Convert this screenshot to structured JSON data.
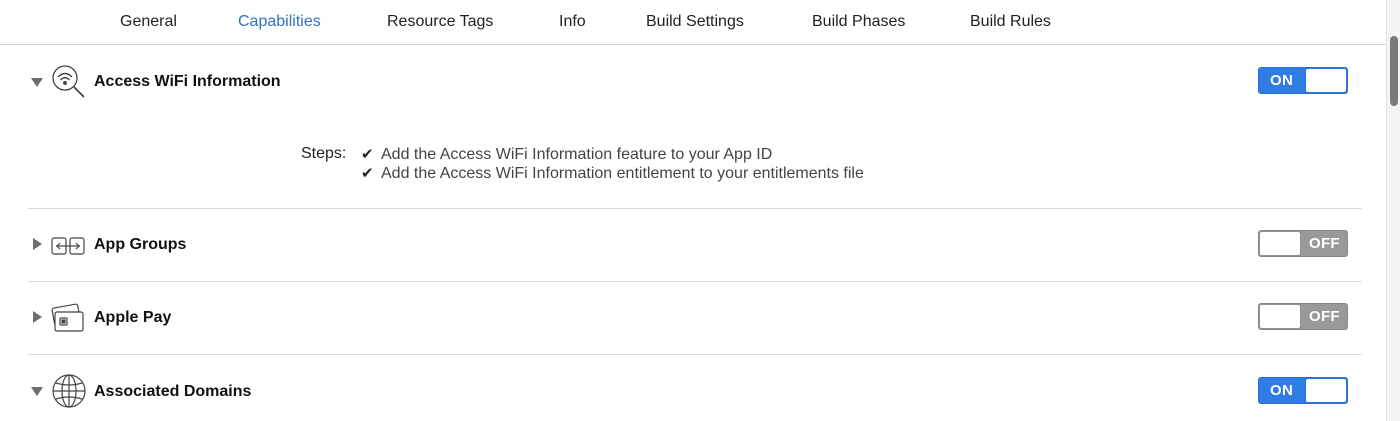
{
  "tabs": [
    {
      "label": "General"
    },
    {
      "label": "Capabilities",
      "active": true
    },
    {
      "label": "Resource Tags"
    },
    {
      "label": "Info"
    },
    {
      "label": "Build Settings"
    },
    {
      "label": "Build Phases"
    },
    {
      "label": "Build Rules"
    }
  ],
  "capabilities": [
    {
      "title": "Access WiFi Information",
      "icon": "wifi-search-icon",
      "expanded": true,
      "toggle": "ON",
      "steps_label": "Steps:",
      "steps": [
        "Add the Access WiFi Information feature to your App ID",
        "Add the Access WiFi Information entitlement to your entitlements file"
      ]
    },
    {
      "title": "App Groups",
      "icon": "app-groups-icon",
      "expanded": false,
      "toggle": "OFF"
    },
    {
      "title": "Apple Pay",
      "icon": "apple-pay-cards-icon",
      "expanded": false,
      "toggle": "OFF"
    },
    {
      "title": "Associated Domains",
      "icon": "globe-icon",
      "expanded": true,
      "toggle": "ON"
    }
  ],
  "colors": {
    "accent": "#3170c6",
    "toggle_on": "#2f7de4",
    "toggle_off": "#999999"
  }
}
